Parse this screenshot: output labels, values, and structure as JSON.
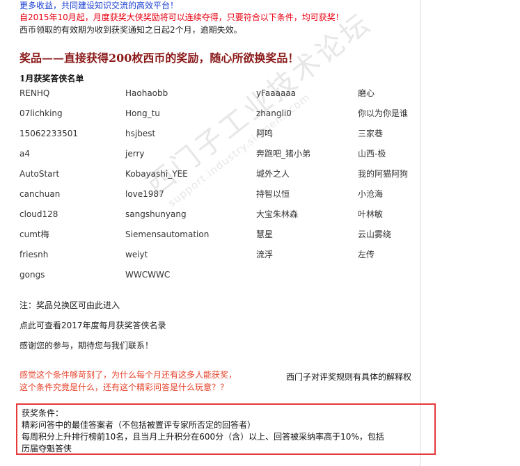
{
  "intro": {
    "line1": "更多收益，共同建设知识交流的高效平台！",
    "line2": "自2015年10月起，月度获奖大侠奖励将可以连续夺得，只要符合以下条件，均可获奖！",
    "line3": "西币领取的有效期为收到获奖通知之日起2个月，逾期失效。"
  },
  "heading": "奖品——直接获得200枚西币的奖励，随心所欲换奖品！",
  "list_title": "1月获奖答侠名单",
  "winners": [
    [
      "RENHQ",
      "Haohaobb",
      "yFaaaaaa",
      "磨心"
    ],
    [
      "07lichking",
      "Hong_tu",
      "zhangli0",
      "你以为你是谁"
    ],
    [
      "15062233501",
      "hsjbest",
      "阿鸣",
      "三家巷"
    ],
    [
      "a4",
      "jerry",
      "奔跑吧_猪小弟",
      "山西-极"
    ],
    [
      "AutoStart",
      "Kobayashi_YEE",
      "城外之人",
      "我的阿猫阿狗"
    ],
    [
      "canchuan",
      "love1987",
      "持智以恒",
      "小沧海"
    ],
    [
      "cloud128",
      "sangshunyang",
      "大宝朱林森",
      "叶林敏"
    ],
    [
      "cumt梅",
      "Siemensautomation",
      "慧星",
      "云山雾绕"
    ],
    [
      "friesnh",
      "weiyt",
      "流浮",
      "左传"
    ],
    [
      "gongs",
      "WWCWWC",
      "",
      ""
    ]
  ],
  "notes": {
    "exchange": "注：奖品兑换区可由此进入",
    "history": "点此可查看2017年度每月获奖答侠名录",
    "thanks": "感谢您的参与，期待您与我们联系！"
  },
  "question": {
    "line1": "感觉这个条件够苛刻了，为什么每个月还有这多人能获奖，",
    "line2": "这个条件究竟是什么，还有这个精彩问答是什么玩意？？"
  },
  "rights": "西门子对评奖规则有具体的解释权",
  "conditions": {
    "title": "获奖条件：",
    "item1": "精彩问答中的最佳答案者（不包括被置评专家所否定的回答者）",
    "item2": "每周积分上升排行榜前10名，且当月上升积分在600分（含）以上、回答被采纳率高于10%，包括",
    "item3": "历届夺魁答侠"
  },
  "watermark": {
    "text": "西门子工业技术论坛",
    "url": "support.industry.siemens.com"
  },
  "colors": {
    "link_blue": "#1a3fd0",
    "alert_red": "#e60012",
    "heading_red": "#8b1a1a",
    "question_red": "#e6412a",
    "highlight_border": "#e5393a"
  }
}
